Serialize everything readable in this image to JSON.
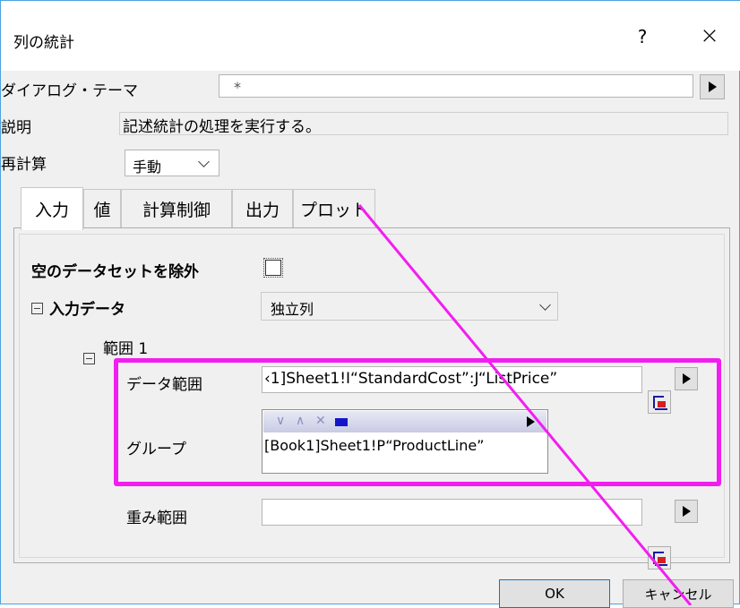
{
  "window": {
    "title": "列の統計",
    "help_label": "?",
    "close_label": "×"
  },
  "theme": {
    "label": "ダイアログ・テーマ",
    "value": "*"
  },
  "description": {
    "label": "説明",
    "value": "記述統計の処理を実行する。"
  },
  "recalc": {
    "label": "再計算",
    "value": "手動"
  },
  "tabs": [
    {
      "label": "入力",
      "active": true
    },
    {
      "label": "値"
    },
    {
      "label": "計算制御"
    },
    {
      "label": "出力"
    },
    {
      "label": "プロット"
    }
  ],
  "input": {
    "exclude_empty_label": "空のデータセットを除外",
    "exclude_empty_checked": false,
    "input_data_label": "入力データ",
    "input_data_value": "独立列",
    "range_label": "範囲 1",
    "data_range_label": "データ範囲",
    "data_range_value": "‹1]Sheet1!I“StandardCost”:J“ListPrice”",
    "group_label": "グループ",
    "group_value": "[Book1]Sheet1!P“ProductLine”",
    "weight_range_label": "重み範囲",
    "weight_range_value": ""
  },
  "buttons": {
    "ok": "OK",
    "cancel": "キャンセル"
  },
  "colors": {
    "highlight": "#f21ef0",
    "accent_border": "#4aa3df"
  },
  "icons": [
    "help-icon",
    "close-icon",
    "arrow-right-icon",
    "dropdown-chevron-icon",
    "range-select-icon",
    "collapse-tree-icon"
  ]
}
